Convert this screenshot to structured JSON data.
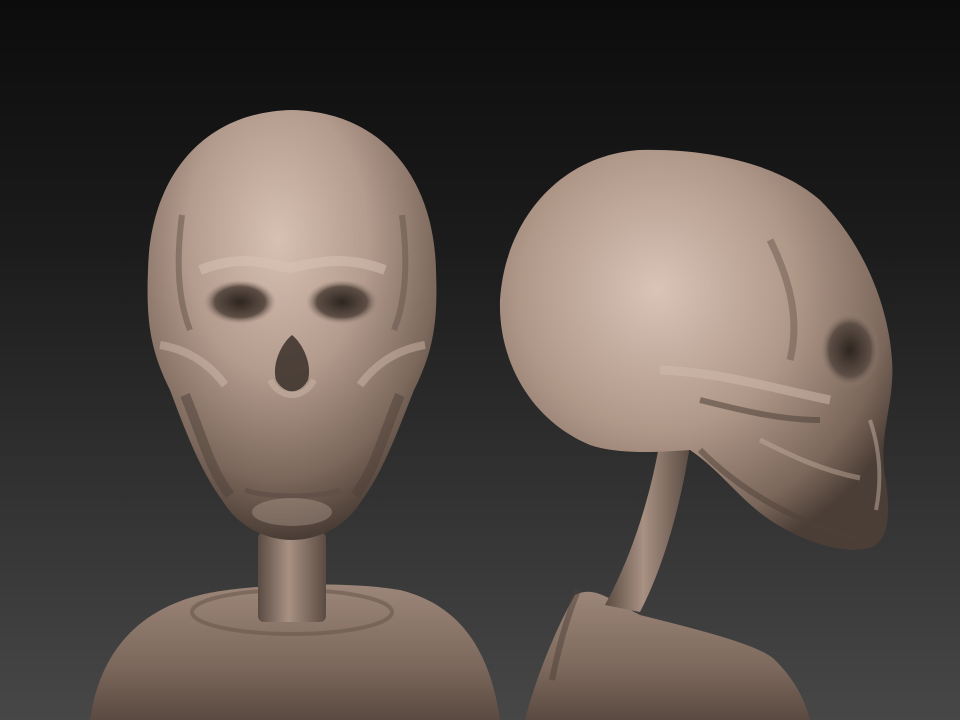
{
  "scene": {
    "subject": "skull-sculpt",
    "views": [
      {
        "id": "front",
        "label": ""
      },
      {
        "id": "side",
        "label": ""
      }
    ],
    "colors": {
      "background_top": "#0c0c0c",
      "background_bottom": "#474747",
      "clay_light": "#cbb4a7",
      "clay_mid": "#9c8679",
      "clay_shadow": "#5e4f46",
      "clay_dark": "#2e2620"
    }
  }
}
